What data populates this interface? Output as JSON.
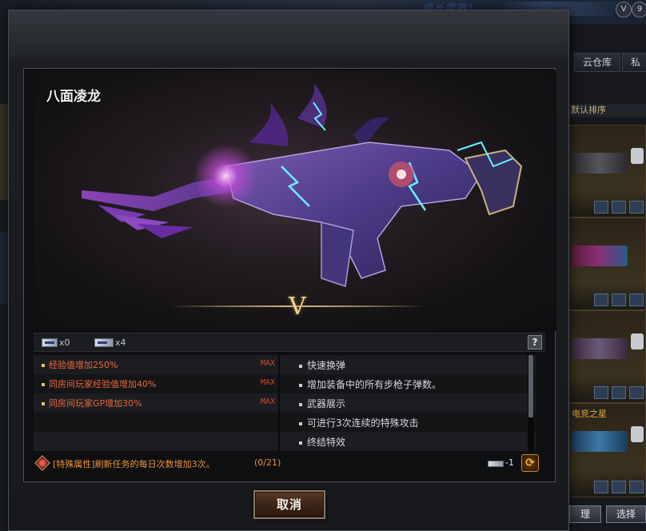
{
  "background": {
    "banner_text": "成长武器!",
    "toggle_labels": [
      "V",
      "9"
    ],
    "tabs": [
      {
        "label": "云仓库"
      },
      {
        "label": "私"
      }
    ],
    "sort_label": "默认排序",
    "card_captions": [
      "",
      "",
      "",
      "电竞之星"
    ],
    "bottom_buttons": [
      {
        "label": "理"
      },
      {
        "label": "选择"
      }
    ]
  },
  "dialog": {
    "weapon_name": "八面凌龙",
    "rank_numeral": "V",
    "parts": [
      {
        "icon": "part-chip-icon",
        "count": "x0"
      },
      {
        "icon": "part-chip-icon",
        "count": "x4"
      }
    ],
    "help_label": "?",
    "attributes_left": [
      {
        "text": "经验值增加250%",
        "max": "MAX"
      },
      {
        "text": "同房间玩家经验值增加40%",
        "max": "MAX"
      },
      {
        "text": "同房间玩家GP增加30%",
        "max": "MAX"
      }
    ],
    "attributes_right": [
      {
        "text": "快速换弹"
      },
      {
        "text": "增加装备中的所有步枪子弹数。"
      },
      {
        "text": "武器展示"
      },
      {
        "text": "可进行3次连续的特殊攻击"
      },
      {
        "text": "终结特效"
      }
    ],
    "special": {
      "text": "[特殊属性]刷新任务的每日次数增加3次。",
      "progress": "(0/21)",
      "cost": "-1"
    },
    "cancel_label": "取消",
    "colors": {
      "attribute_orange": "#e8673f",
      "max_red": "#d9452f",
      "special_orange": "#e8943a",
      "gold": "#e8d49b"
    }
  }
}
